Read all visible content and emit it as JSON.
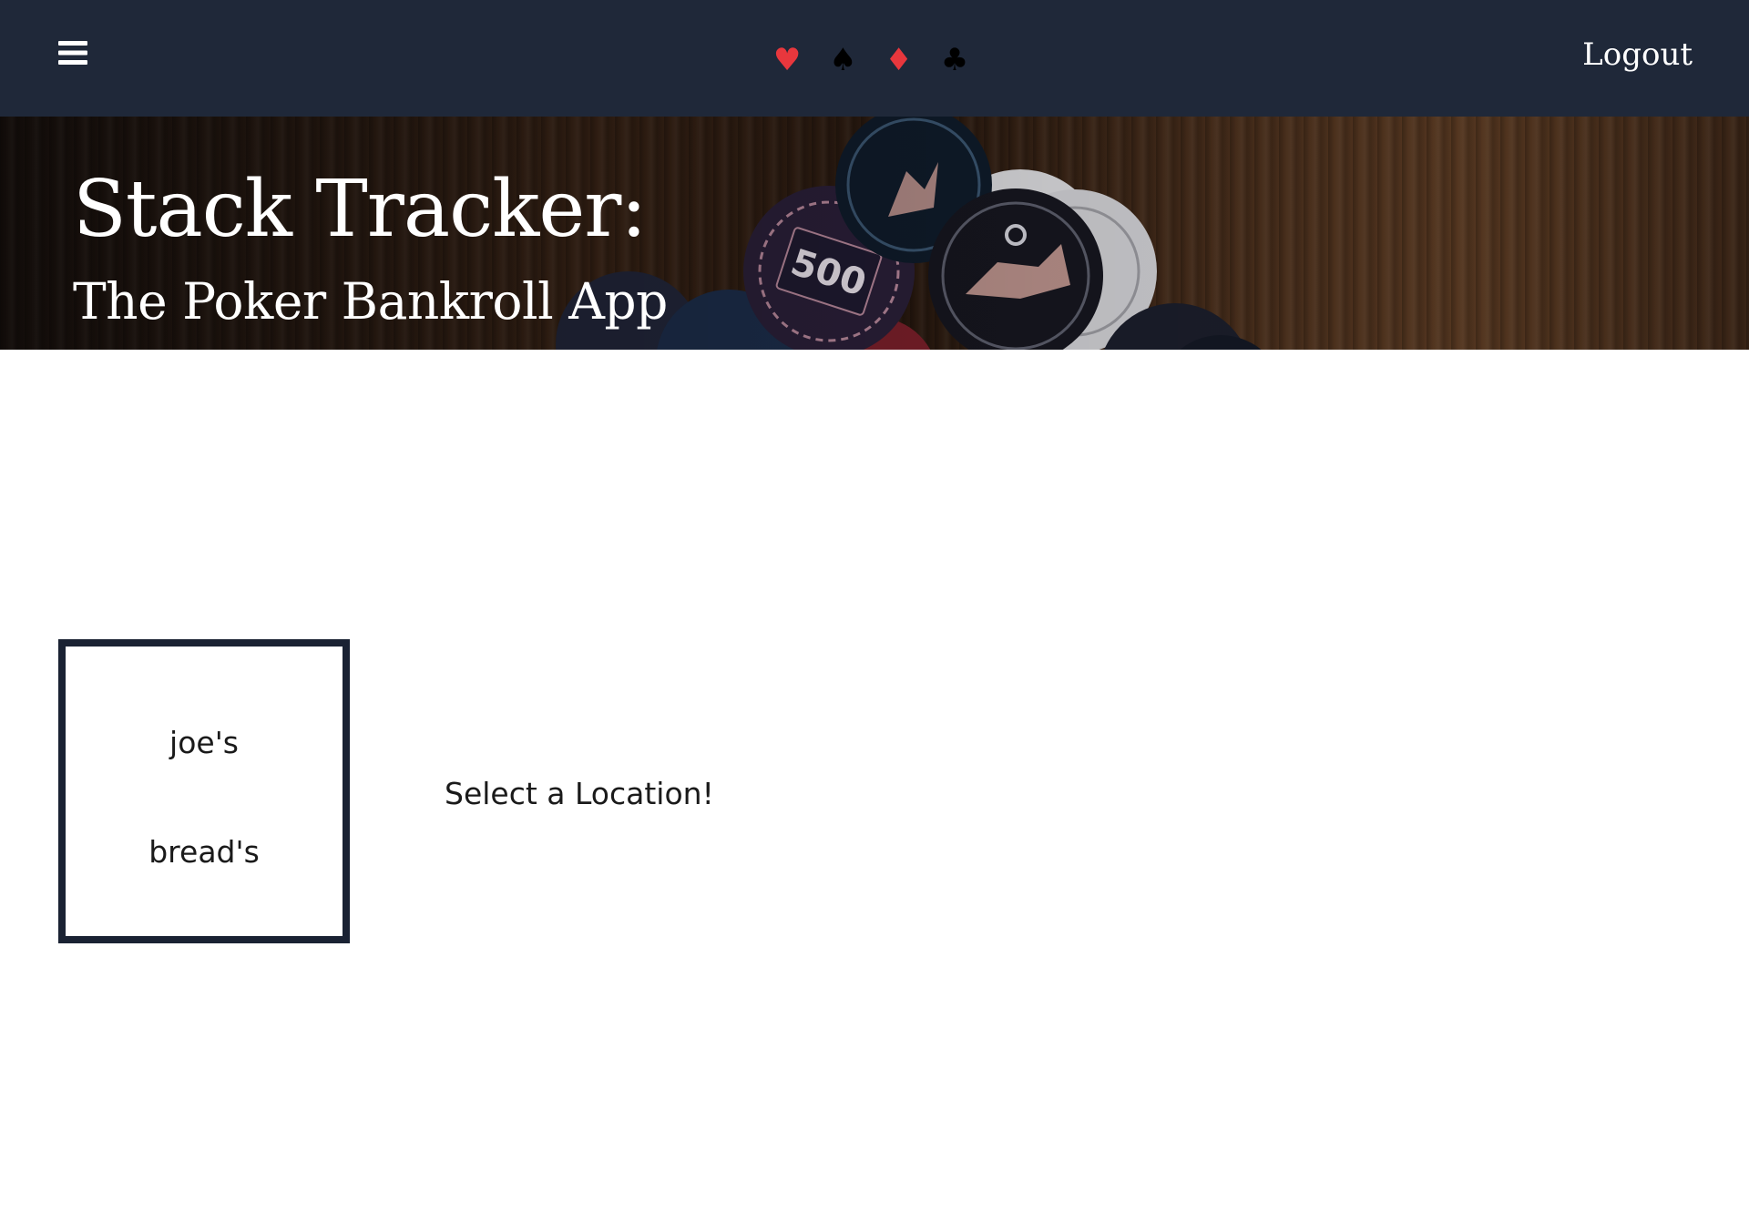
{
  "topbar": {
    "menu_icon": "hamburger-menu-icon",
    "suits": [
      {
        "glyph": "♥",
        "color": "#e8373d"
      },
      {
        "glyph": "♠",
        "color": "#000000"
      },
      {
        "glyph": "♦",
        "color": "#e8373d"
      },
      {
        "glyph": "♣",
        "color": "#000000"
      }
    ],
    "logout_label": "Logout"
  },
  "hero": {
    "title": "Stack Tracker:",
    "subtitle": "The Poker Bankroll App",
    "chip_label": "500"
  },
  "locations": {
    "items": [
      {
        "label": "joe's"
      },
      {
        "label": "bread's"
      }
    ]
  },
  "main": {
    "prompt": "Select a Location!"
  },
  "colors": {
    "topbar_bg": "#1f2839",
    "list_border": "#1a2233",
    "suit_red": "#e8373d"
  }
}
